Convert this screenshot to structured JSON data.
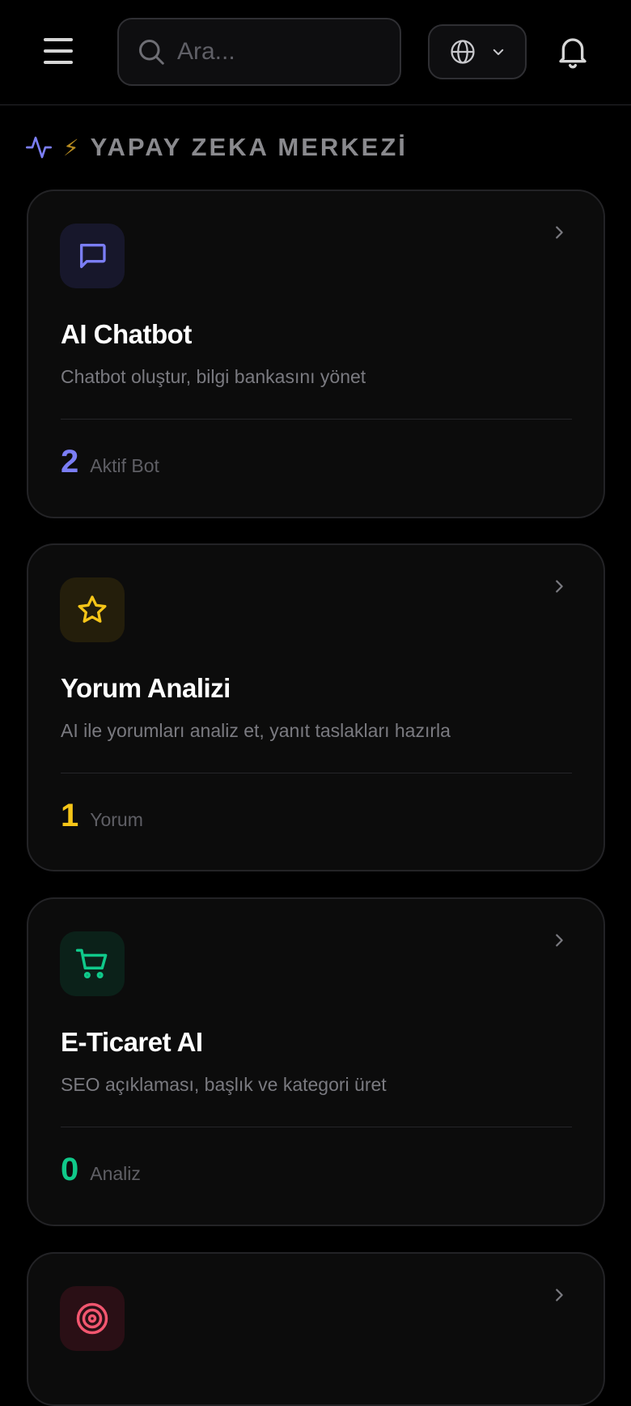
{
  "topbar": {
    "menu_icon": "hamburger-menu-icon",
    "search": {
      "placeholder": "Ara...",
      "value": "",
      "icon": "search-icon"
    },
    "language": {
      "icon": "globe-icon",
      "dropdown_icon": "chevron-down-icon"
    },
    "notifications_icon": "bell-icon"
  },
  "section": {
    "icon": "activity-icon",
    "emoji": "⚡",
    "title": "YAPAY ZEKA MERKEZİ"
  },
  "colors": {
    "background": "#000000",
    "card": "#0c0c0c",
    "chatbot_accent": "#7b7ef5",
    "review_accent": "#f5c518",
    "ecommerce_accent": "#10c98a",
    "target_accent": "#f2566f"
  },
  "cards": [
    {
      "icon": "message-square-icon",
      "title": "AI Chatbot",
      "description": "Chatbot oluştur, bilgi bankasını yönet",
      "stat_value": "2",
      "stat_label": "Aktif Bot"
    },
    {
      "icon": "star-icon",
      "title": "Yorum Analizi",
      "description": "AI ile yorumları analiz et, yanıt taslakları hazırla",
      "stat_value": "1",
      "stat_label": "Yorum"
    },
    {
      "icon": "shopping-cart-icon",
      "title": "E-Ticaret AI",
      "description": "SEO açıklaması, başlık ve kategori üret",
      "stat_value": "0",
      "stat_label": "Analiz"
    },
    {
      "icon": "target-icon",
      "title": "",
      "description": "",
      "stat_value": "",
      "stat_label": ""
    }
  ]
}
